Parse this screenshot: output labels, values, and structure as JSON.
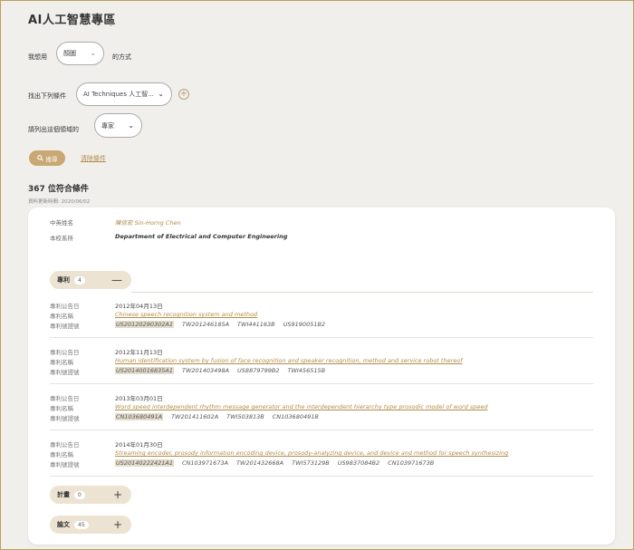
{
  "page": {
    "title": "AI人工智慧專區",
    "title_dot": "。"
  },
  "filters": {
    "row1_label": "我想用",
    "row1_select": "顏圖",
    "row1_suffix": "的方式",
    "row2_label": "找出下列條件",
    "row2_select": "AI Techniques 人工智...",
    "row3_label": "請列出這個領域的",
    "row3_select": "專家",
    "search_button": "搜尋",
    "clear_link": "清除條件"
  },
  "results": {
    "count_text": "367 位符合條件",
    "data_date": "資料更新時間: 2020/06/02"
  },
  "card": {
    "name_label": "中英姓名",
    "name_value": "陳信宏 Sin-Horng Chen",
    "dept_label": "本校系所",
    "dept_value": "Department of Electrical and Computer Engineering",
    "sections": {
      "patents": {
        "label": "專利",
        "count": "4",
        "toggle": "—"
      },
      "projects": {
        "label": "計畫",
        "count": "0",
        "toggle": "+"
      },
      "papers": {
        "label": "論文",
        "count": "45",
        "toggle": "+"
      }
    },
    "patent_labels": {
      "date": "專利公告日",
      "name": "專利名稱",
      "number": "專利號證號"
    },
    "patents": [
      {
        "date": "2012年04月13日",
        "title": "Chinese speech recognition system and method",
        "numbers": [
          "US20120290302A1",
          "TW201246185A",
          "TWI441163B",
          "US9190051B2"
        ]
      },
      {
        "date": "2012年11月13日",
        "title": "Human identification system by fusion of face recognition and speaker recognition, method and service robot thereof",
        "numbers": [
          "US20140016835A1",
          "TW201403498A",
          "US8879799B2",
          "TWI456515B"
        ]
      },
      {
        "date": "2013年03月01日",
        "title": "Word speed interdependent rhythm message generator and the interdependent hierarchy type prosodic model of word speed",
        "numbers": [
          "CN103680491A",
          "TW201411602A",
          "TWI503813B",
          "CN103680491B"
        ]
      },
      {
        "date": "2014年01月30日",
        "title": "Streaming encoder, prosody information encoding device, prosody-analyzing device, and device and method for speech synthesizing",
        "numbers": [
          "US20140222421A1",
          "CN103971673A",
          "TW201432668A",
          "TWI573129B",
          "US9837084B2",
          "CN103971673B"
        ]
      }
    ]
  },
  "colors": {
    "accent": "#c9a874",
    "link": "#b28c4a",
    "pill_bg": "#ece3d2",
    "page_bg": "#f1efec"
  }
}
